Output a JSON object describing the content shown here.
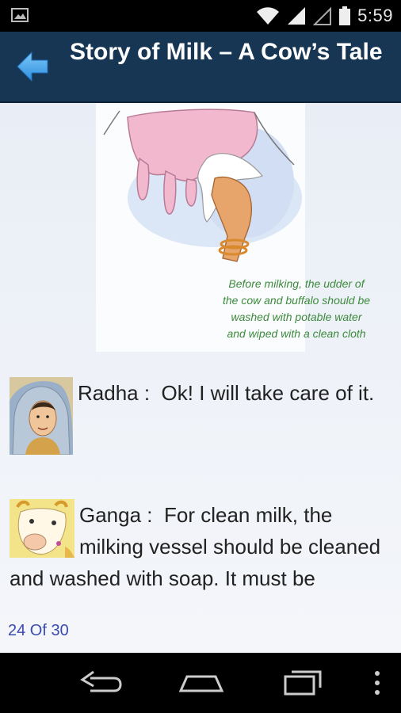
{
  "status_bar": {
    "time": "5:59",
    "icons": [
      "image-notification-icon",
      "wifi-icon",
      "signal-icon",
      "signal-empty-icon",
      "battery-icon"
    ]
  },
  "action_bar": {
    "back_icon": "arrow-left-icon",
    "title": "Story of Milk – A Cow’s Tale",
    "color": "#173654"
  },
  "illustration": {
    "caption_lines": [
      "Before milking, the udder of",
      "the cow and buffalo should be",
      "washed with potable water",
      "and wiped with a clean cloth"
    ]
  },
  "dialogs": [
    {
      "avatar": "radha-avatar",
      "speaker": "Radha",
      "separator": " :  ",
      "text": "Ok! I will take care of it."
    },
    {
      "avatar": "ganga-cow-avatar",
      "speaker": "Ganga",
      "separator": " :  ",
      "text": "For clean milk, the milking vessel should be cleaned and washed with soap. It must be"
    }
  ],
  "footer": {
    "page_indicator": "24 Of 30"
  },
  "nav_bar": {
    "back_icon": "nav-back-icon",
    "home_icon": "nav-home-icon",
    "recents_icon": "nav-recents-icon",
    "menu_icon": "overflow-menu-icon"
  }
}
